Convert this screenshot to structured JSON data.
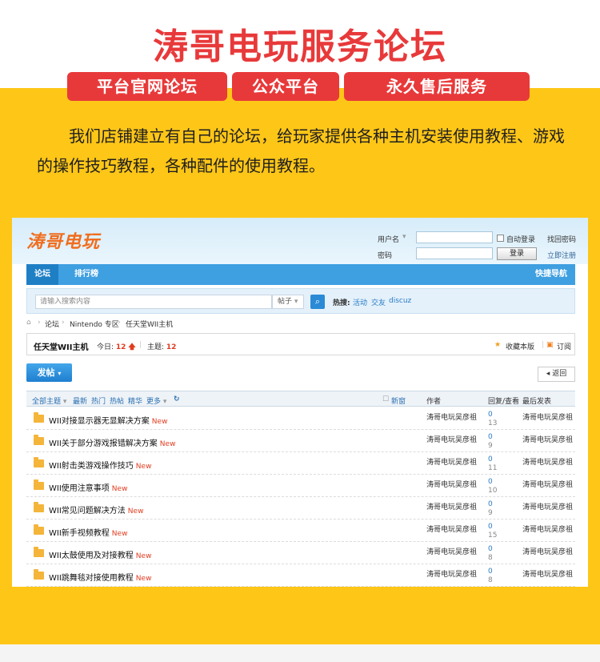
{
  "banner": {
    "title": "涛哥电玩服务论坛",
    "pills": [
      "平台官网论坛",
      "公众平台",
      "永久售后服务"
    ],
    "intro": "我们店铺建立有自己的论坛，给玩家提供各种主机安装使用教程、游戏的操作技巧教程，各种配件的使用教程。"
  },
  "colors": {
    "accent_red": "#e8393a",
    "background_yellow": "#fec617",
    "nav_blue": "#3e9fe1"
  },
  "forum": {
    "logo": "涛哥电玩",
    "login": {
      "username_label": "用户名",
      "password_label": "密码",
      "auto_login": "自动登录",
      "login_button": "登录",
      "find_password": "找回密码",
      "register": "立即注册"
    },
    "nav": {
      "tabs": [
        "论坛",
        "排行榜"
      ],
      "quick_nav": "快捷导航"
    },
    "search": {
      "placeholder": "请输入搜索内容",
      "type": "帖子",
      "hot_label": "热搜:",
      "hot_links": [
        "活动",
        "交友",
        "discuz"
      ]
    },
    "breadcrumb": [
      "论坛",
      "Nintendo 专区",
      "任天堂WII主机"
    ],
    "board": {
      "title": "任天堂WII主机",
      "today_label": "今日:",
      "today_count": "12",
      "topics_label": "主题:",
      "topics_count": "12",
      "favorite": "收藏本版",
      "subscribe": "订阅"
    },
    "post_button": "发帖",
    "back_button": "返回",
    "table_header": {
      "filters": [
        "全部主题",
        "最新",
        "热门",
        "热帖",
        "精华",
        "更多"
      ],
      "new_window": "新窗",
      "author": "作者",
      "reply_view": "回复/查看",
      "last_post": "最后发表"
    },
    "threads": [
      {
        "title": "WII对接显示器无显解决方案",
        "tag": "New",
        "author": "涛哥电玩吴彦祖",
        "replies": "0",
        "views": "13",
        "last": "涛哥电玩吴彦祖"
      },
      {
        "title": "WII关于部分游戏报错解决方案",
        "tag": "New",
        "author": "涛哥电玩吴彦祖",
        "replies": "0",
        "views": "9",
        "last": "涛哥电玩吴彦祖"
      },
      {
        "title": "WII射击类游戏操作技巧",
        "tag": "New",
        "author": "涛哥电玩吴彦祖",
        "replies": "0",
        "views": "11",
        "last": "涛哥电玩吴彦祖"
      },
      {
        "title": "WII使用注意事项",
        "tag": "New",
        "author": "涛哥电玩吴彦祖",
        "replies": "0",
        "views": "10",
        "last": "涛哥电玩吴彦祖"
      },
      {
        "title": "WII常见问题解决方法",
        "tag": "New",
        "author": "涛哥电玩吴彦祖",
        "replies": "0",
        "views": "9",
        "last": "涛哥电玩吴彦祖"
      },
      {
        "title": "WII新手视频教程",
        "tag": "New",
        "author": "涛哥电玩吴彦祖",
        "replies": "0",
        "views": "15",
        "last": "涛哥电玩吴彦祖"
      },
      {
        "title": "WII太鼓使用及对接教程",
        "tag": "New",
        "author": "涛哥电玩吴彦祖",
        "replies": "0",
        "views": "8",
        "last": "涛哥电玩吴彦祖"
      },
      {
        "title": "WII跳舞毯对接使用教程",
        "tag": "New",
        "author": "涛哥电玩吴彦祖",
        "replies": "0",
        "views": "8",
        "last": "涛哥电玩吴彦祖"
      }
    ]
  }
}
